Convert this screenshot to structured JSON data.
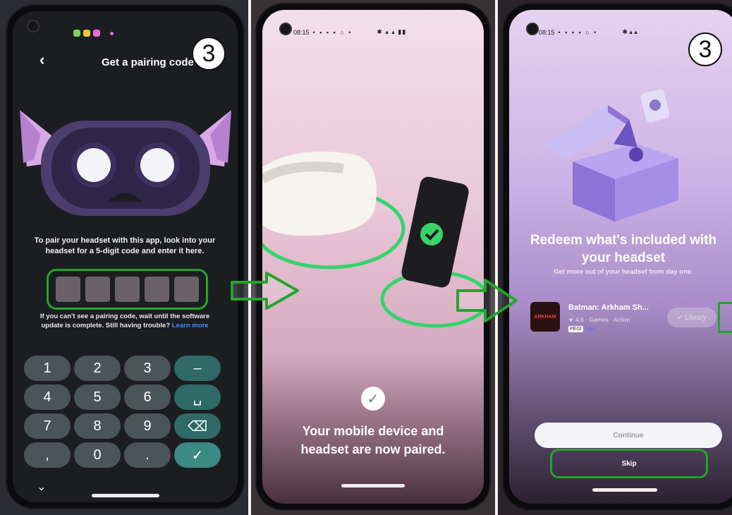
{
  "panel1": {
    "title": "Get a pairing code",
    "step_number": "3",
    "instruction": "To pair your headset with this app, look into your headset for a 5-digit code and enter it here.",
    "hint_text": "If you can't see a pairing code, wait until the software update is complete. Still having trouble?",
    "hint_link": "Learn more",
    "code_boxes": 5,
    "keypad": [
      {
        "label": "1",
        "type": "digit"
      },
      {
        "label": "2",
        "type": "digit"
      },
      {
        "label": "3",
        "type": "digit"
      },
      {
        "label": "–",
        "type": "action"
      },
      {
        "label": "4",
        "type": "digit"
      },
      {
        "label": "5",
        "type": "digit"
      },
      {
        "label": "6",
        "type": "digit"
      },
      {
        "label": "␣",
        "type": "action"
      },
      {
        "label": "7",
        "type": "digit"
      },
      {
        "label": "8",
        "type": "digit"
      },
      {
        "label": "9",
        "type": "digit"
      },
      {
        "label": "⌫",
        "type": "action"
      },
      {
        "label": ",",
        "type": "digit"
      },
      {
        "label": "0",
        "type": "digit"
      },
      {
        "label": ".",
        "type": "digit"
      },
      {
        "label": "✓",
        "type": "done"
      }
    ]
  },
  "panel2": {
    "status_time": "08:15",
    "paired_message": "Your mobile device and headset are now paired."
  },
  "panel3": {
    "status_time": "08:15",
    "step_number": "3",
    "title": "Redeem what's included with your headset",
    "subtitle": "Get more out of your headset from day one.",
    "game": {
      "title": "Batman: Arkham Sh...",
      "meta": "★ 4.6 · Games · Action",
      "rating_box": "PEGI",
      "rating": "16+",
      "library_label": "✓ Library"
    },
    "continue_label": "Continue",
    "skip_label": "Skip"
  },
  "colors": {
    "highlight_green": "#22a52b",
    "paired_ring_green": "#33d46a"
  }
}
